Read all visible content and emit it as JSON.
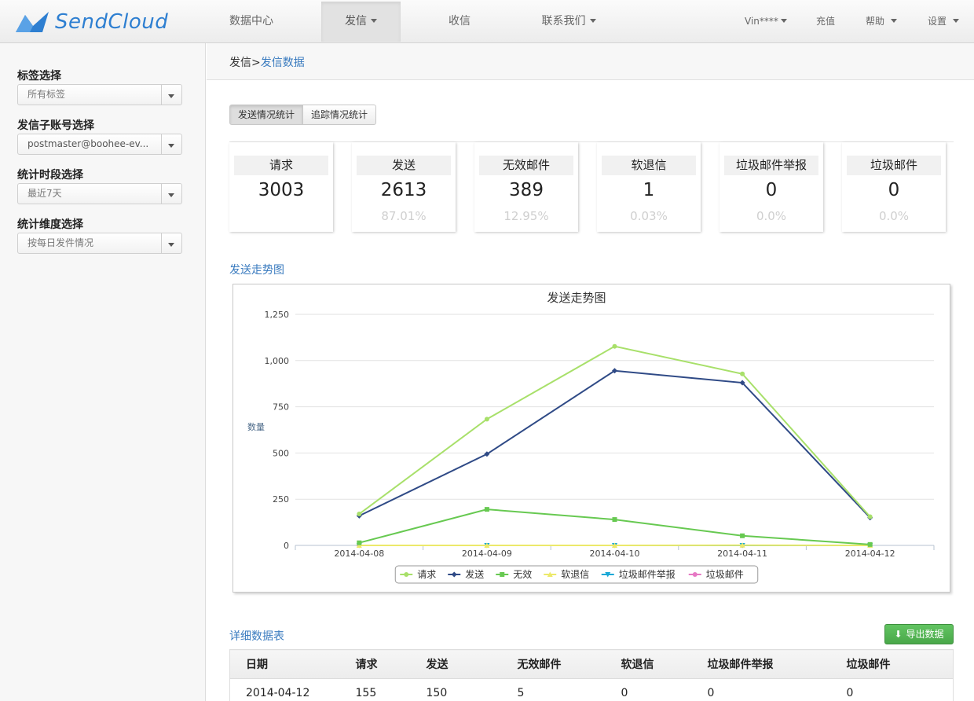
{
  "brand": {
    "name": "SendCloud",
    "accent": "#2e7fd1"
  },
  "nav": {
    "items": [
      {
        "label": "数据中心",
        "active": false,
        "has_menu": false
      },
      {
        "label": "发信",
        "active": true,
        "has_menu": true
      },
      {
        "label": "收信",
        "active": false,
        "has_menu": false
      },
      {
        "label": "联系我们",
        "active": false,
        "has_menu": true
      }
    ],
    "right": [
      {
        "label": "Vin****",
        "has_menu": true
      },
      {
        "label": "充值",
        "has_menu": false
      },
      {
        "label": "帮助",
        "has_menu": true
      },
      {
        "label": "设置",
        "has_menu": true
      }
    ]
  },
  "sidebar": {
    "filters": [
      {
        "label": "标签选择",
        "value": "所有标签"
      },
      {
        "label": "发信子账号选择",
        "value": "postmaster@boohee-ev..."
      },
      {
        "label": "统计时段选择",
        "value": "最近7天"
      },
      {
        "label": "统计维度选择",
        "value": "按每日发件情况"
      }
    ]
  },
  "breadcrumb": {
    "parent": "发信",
    "separator": ">",
    "current": "发信数据"
  },
  "tabs": [
    {
      "label": "发送情况统计",
      "active": true
    },
    {
      "label": "追踪情况统计",
      "active": false
    }
  ],
  "stats": [
    {
      "label": "请求",
      "value": "3003",
      "percent": ""
    },
    {
      "label": "发送",
      "value": "2613",
      "percent": "87.01%"
    },
    {
      "label": "无效邮件",
      "value": "389",
      "percent": "12.95%"
    },
    {
      "label": "软退信",
      "value": "1",
      "percent": "0.03%"
    },
    {
      "label": "垃圾邮件举报",
      "value": "0",
      "percent": "0.0%"
    },
    {
      "label": "垃圾邮件",
      "value": "0",
      "percent": "0.0%"
    }
  ],
  "trend_section_title": "发送走势图",
  "chart_data": {
    "type": "line",
    "title": "发送走势图",
    "xlabel": "",
    "ylabel": "数量",
    "categories": [
      "2014-04-08",
      "2014-04-09",
      "2014-04-10",
      "2014-04-11",
      "2014-04-12"
    ],
    "y_ticks": [
      "0",
      "250",
      "500",
      "750",
      "1,000",
      "1,250"
    ],
    "ylim": [
      0,
      1250
    ],
    "grid": true,
    "legend_position": "bottom",
    "series": [
      {
        "name": "请求",
        "color": "#a8e06a",
        "marker": "circle",
        "values": [
          170,
          683,
          1077,
          928,
          155
        ]
      },
      {
        "name": "发送",
        "color": "#2f4a86",
        "marker": "diamond",
        "values": [
          160,
          494,
          945,
          880,
          150
        ]
      },
      {
        "name": "无效",
        "color": "#67c951",
        "marker": "square",
        "values": [
          14,
          195,
          140,
          52,
          5
        ]
      },
      {
        "name": "软退信",
        "color": "#ece96a",
        "marker": "triangle",
        "values": [
          0,
          0,
          0,
          1,
          0
        ]
      },
      {
        "name": "垃圾邮件举报",
        "color": "#1aa8d6",
        "marker": "triangle-down",
        "values": [
          0,
          0,
          0,
          0,
          0
        ]
      },
      {
        "name": "垃圾邮件",
        "color": "#e678c4",
        "marker": "circle",
        "values": [
          0,
          0,
          0,
          0,
          0
        ]
      }
    ]
  },
  "detail": {
    "title": "详细数据表",
    "export_label": "导出数据",
    "columns": [
      "日期",
      "请求",
      "发送",
      "无效邮件",
      "软退信",
      "垃圾邮件举报",
      "垃圾邮件"
    ],
    "rows": [
      [
        "2014-04-12",
        "155",
        "150",
        "5",
        "0",
        "0",
        "0"
      ]
    ]
  }
}
